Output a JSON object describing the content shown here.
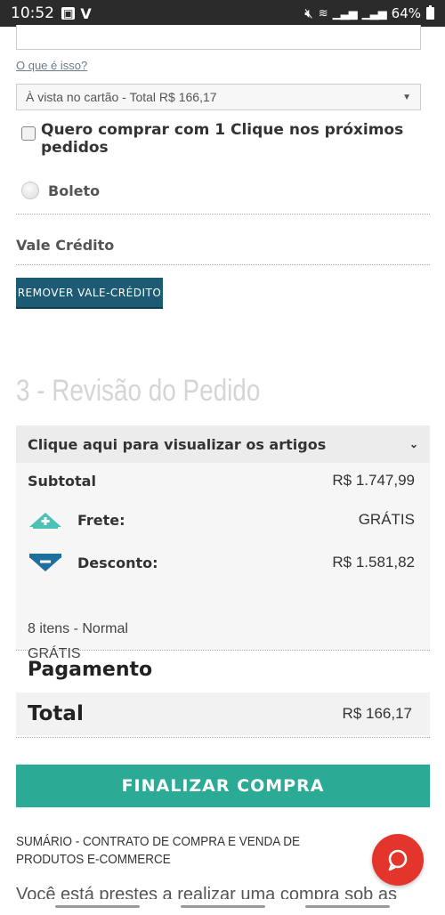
{
  "status_bar": {
    "time": "10:52",
    "battery": "64%"
  },
  "payment": {
    "what_is_this_link": "O que é isso?",
    "installment_select_value": "À vista no cartão - Total R$ 166,17",
    "one_click_label": "Quero comprar com 1 Clique nos próximos pedidos",
    "boleto_label": "Boleto"
  },
  "vale_credito": {
    "title": "Vale Crédito",
    "remove_button": "REMOVER VALE-CRÉDITO"
  },
  "review": {
    "section_title": "3 - Revisão do Pedido",
    "articles_toggle": "Clique aqui para visualizar os artigos",
    "subtotal_label": "Subtotal",
    "subtotal_value": "R$ 1.747,99",
    "frete_label": "Frete:",
    "frete_value": "GRÁTIS",
    "desconto_label": "Desconto:",
    "desconto_value": "R$ 1.581,82",
    "items_summary": "8 itens - Normal",
    "shipping_cost": "GRÁTIS",
    "colors": {
      "frete_icon": "#4cc1b5",
      "desconto_icon": "#1f6f9e"
    }
  },
  "pagamento": {
    "title": "Pagamento",
    "total_label": "Total",
    "total_value": "R$ 166,17"
  },
  "actions": {
    "finalize_button": "FINALIZAR COMPRA"
  },
  "contract": {
    "title": "SUMÁRIO - CONTRATO DE COMPRA E VENDA DE PRODUTOS E-COMMERCE",
    "intro_partial": "Você está prestes a realizar uma compra sob as"
  },
  "theme": {
    "primary_button": "#2bab95",
    "secondary_button": "#1d5a73",
    "chat_button": "#e3352b"
  }
}
